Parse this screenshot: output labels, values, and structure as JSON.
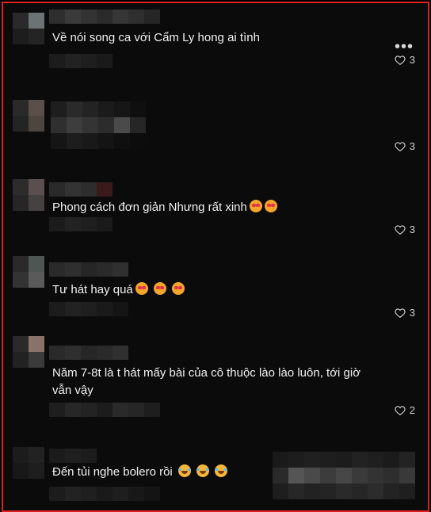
{
  "comments": [
    {
      "text": "Về nói song ca với Cẩm Ly hong ai tình",
      "likes": "3",
      "emojis": []
    },
    {
      "text": "",
      "likes": "3",
      "emojis": []
    },
    {
      "text": "Phong cách đơn giản Nhưng rất xinh",
      "likes": "3",
      "emojis": [
        "heart-eyes-emoji",
        "heart-eyes-emoji"
      ]
    },
    {
      "text": "Tư hát hay quá",
      "likes": "3",
      "emojis": [
        "heart-eyes-emoji",
        "heart-eyes-emoji",
        "heart-eyes-emoji"
      ]
    },
    {
      "text": "Năm 7-8t là t hát mấy bài của cô thuộc lào lào luôn, tới giờ vẫn vậy",
      "likes": "2",
      "emojis": []
    },
    {
      "text": "Đến tủi nghe bolero rồi",
      "likes": "",
      "emojis": [
        "tears-of-joy-emoji",
        "tears-of-joy-emoji",
        "tears-of-joy-emoji"
      ]
    }
  ],
  "icons": {
    "like": "heart-outline-icon",
    "more": "more-horizontal-icon"
  },
  "colors": {
    "border": "#e02020",
    "background": "#0b0b0b",
    "text": "#f1f1f1"
  }
}
